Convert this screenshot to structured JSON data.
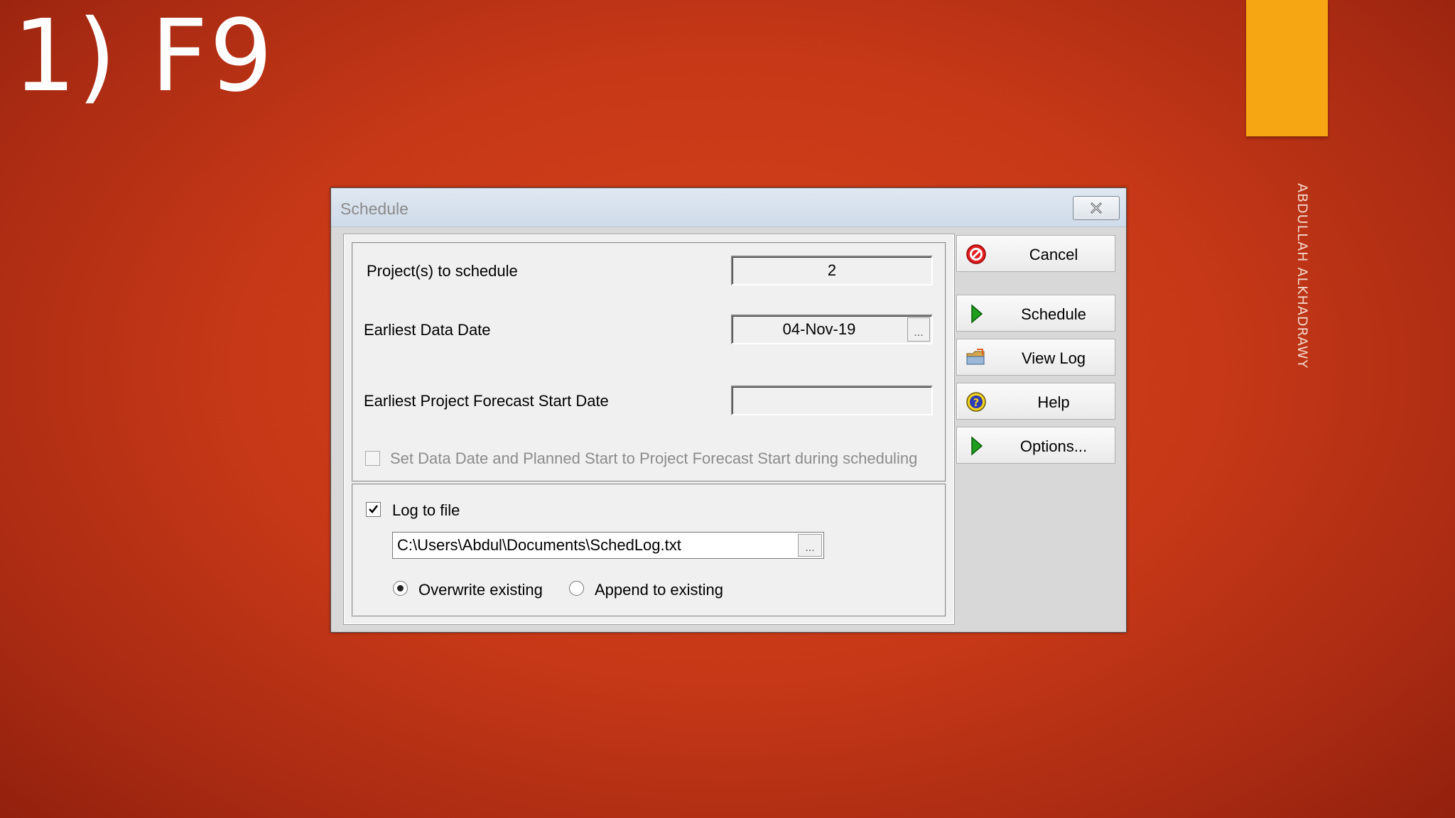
{
  "slide": {
    "title": "1) F9",
    "author": "ABDULLAH ALKHADRAWY",
    "accent_color": "#f5a612"
  },
  "dialog": {
    "title": "Schedule",
    "close_icon": "close-icon",
    "projects_label": "Project(s) to schedule",
    "projects_value": "2",
    "data_date_label": "Earliest Data Date",
    "data_date_value": "04-Nov-19",
    "browse_label": "...",
    "forecast_label": "Earliest Project Forecast Start Date",
    "forecast_value": "",
    "set_data_date_label": "Set Data Date and Planned Start to Project Forecast Start during scheduling",
    "set_data_date_checked": false,
    "log_label": "Log to file",
    "log_checked": true,
    "log_path": "C:\\Users\\Abdul\\Documents\\SchedLog.txt",
    "overwrite_label": "Overwrite existing",
    "append_label": "Append to existing",
    "selected_mode": "overwrite"
  },
  "buttons": {
    "cancel": {
      "label": "Cancel",
      "icon": "stop-icon"
    },
    "schedule": {
      "label": "Schedule",
      "icon": "play-icon"
    },
    "view_log": {
      "label": "View Log",
      "icon": "folder-icon"
    },
    "help": {
      "label": "Help",
      "icon": "help-icon"
    },
    "options": {
      "label": "Options...",
      "icon": "play-icon"
    }
  }
}
